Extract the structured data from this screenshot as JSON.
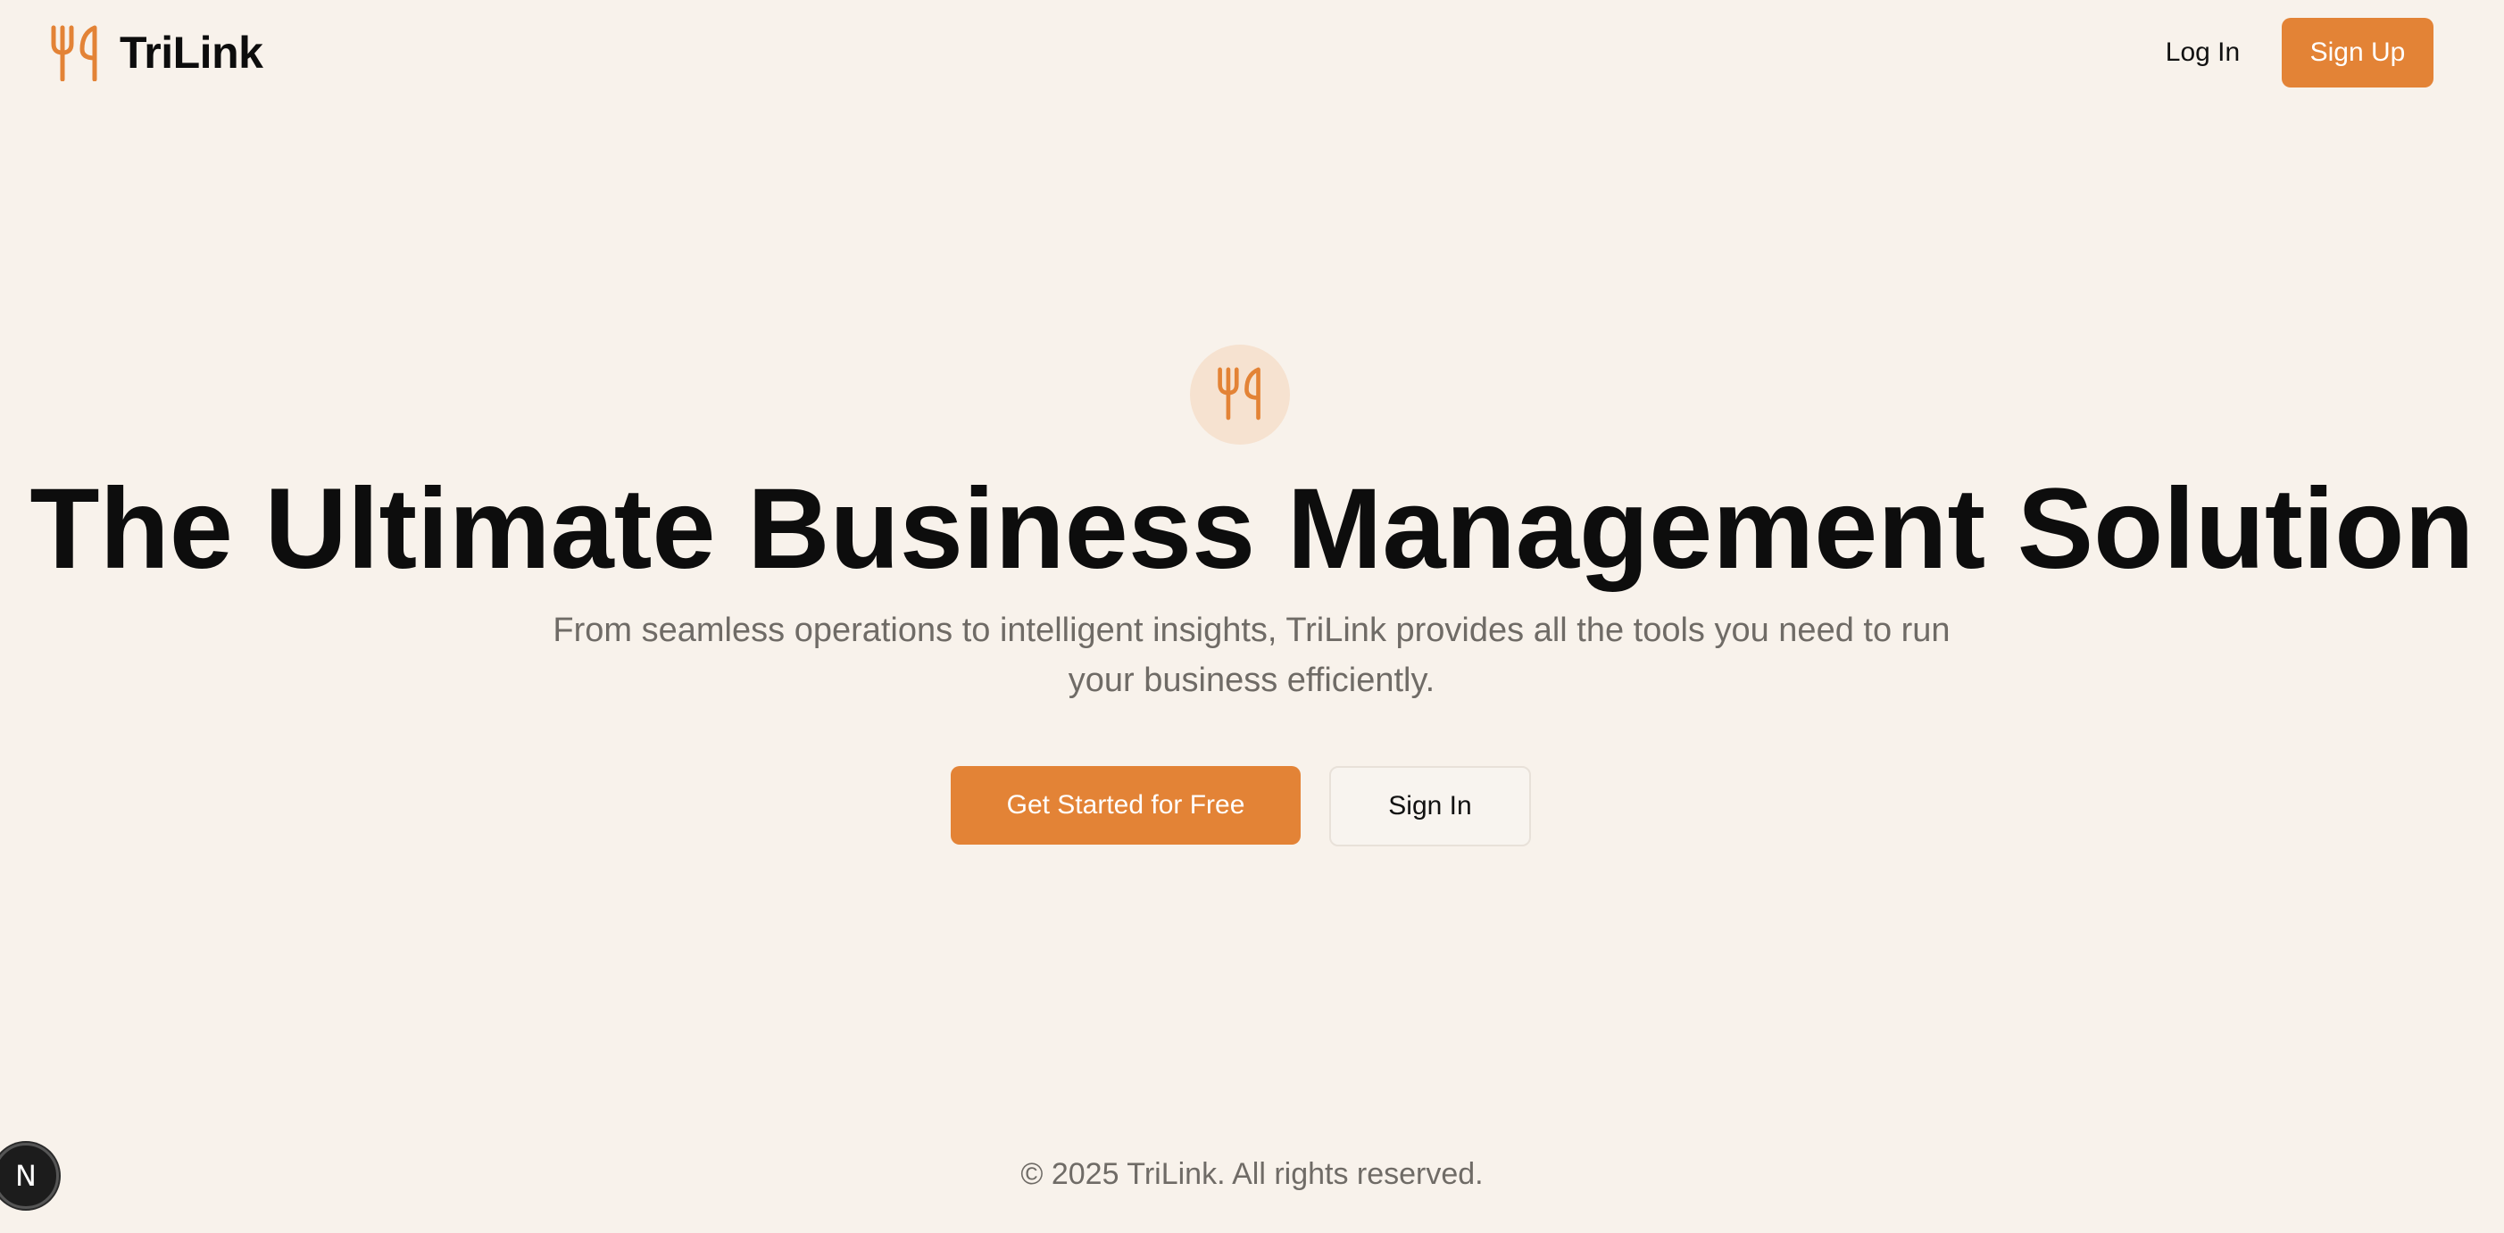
{
  "header": {
    "brand_name": "TriLink",
    "brand_icon": "utensils-icon",
    "login_label": "Log In",
    "signup_label": "Sign Up"
  },
  "hero": {
    "badge_icon": "utensils-icon",
    "title": "The Ultimate Business Management Solution",
    "subtitle": "From seamless operations to intelligent insights, TriLink provides all the tools you need to run your business efficiently.",
    "primary_cta": "Get Started for Free",
    "secondary_cta": "Sign In"
  },
  "footer": {
    "copyright": "© 2025 TriLink. All rights reserved."
  },
  "dev_indicator": {
    "label": "N"
  },
  "colors": {
    "background": "#f8f2eb",
    "accent": "#e38336",
    "badge_bg": "#f6e2d0",
    "muted_text": "#6f6b66"
  }
}
